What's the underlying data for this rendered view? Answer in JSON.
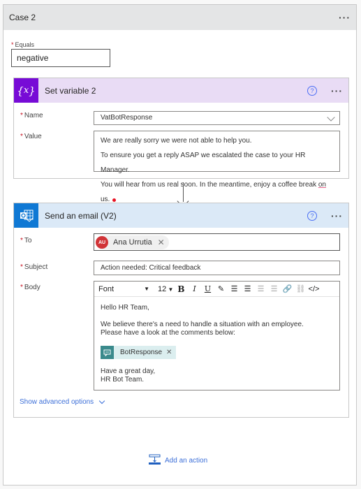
{
  "case": {
    "title": "Case 2",
    "menu_icon": "more-icon",
    "equals_label": "Equals",
    "equals_value": "negative"
  },
  "set_variable": {
    "title": "Set variable 2",
    "icon": "variable-icon",
    "icon_glyph": "{x}",
    "header_color": "#e9dcf5",
    "icon_color": "#770bd6",
    "name_label": "Name",
    "name_value": "VatBotResponse",
    "value_label": "Value",
    "value_lines": [
      "We are really sorry we were not able to help you.",
      "To ensure you get a reply ASAP we escalated the case to your HR Manager.",
      "You will hear from us real soon. In the meantime, enjoy a coffee break ",
      "on",
      " us."
    ]
  },
  "send_email": {
    "title": "Send an email (V2)",
    "icon": "outlook-icon",
    "header_color": "#dbe9f7",
    "icon_color": "#0f78d4",
    "to_label": "To",
    "to_recipient": {
      "initials": "AU",
      "name": "Ana Urrutia"
    },
    "subject_label": "Subject",
    "subject_value": "Action needed: Critical feedback",
    "body_label": "Body",
    "toolbar": {
      "font": "Font",
      "size": "12",
      "bold": "B",
      "italic": "I",
      "underline": "U"
    },
    "body": {
      "greeting": "Hello HR Team,",
      "line1": "We believe there's a need to handle a situation with an employee.",
      "line2": "Please have a look at the comments below:",
      "token": "BotResponse",
      "closing1": "Have a great day,",
      "closing2": "HR Bot Team."
    },
    "advanced_label": "Show advanced options"
  },
  "add_action_label": "Add an action"
}
